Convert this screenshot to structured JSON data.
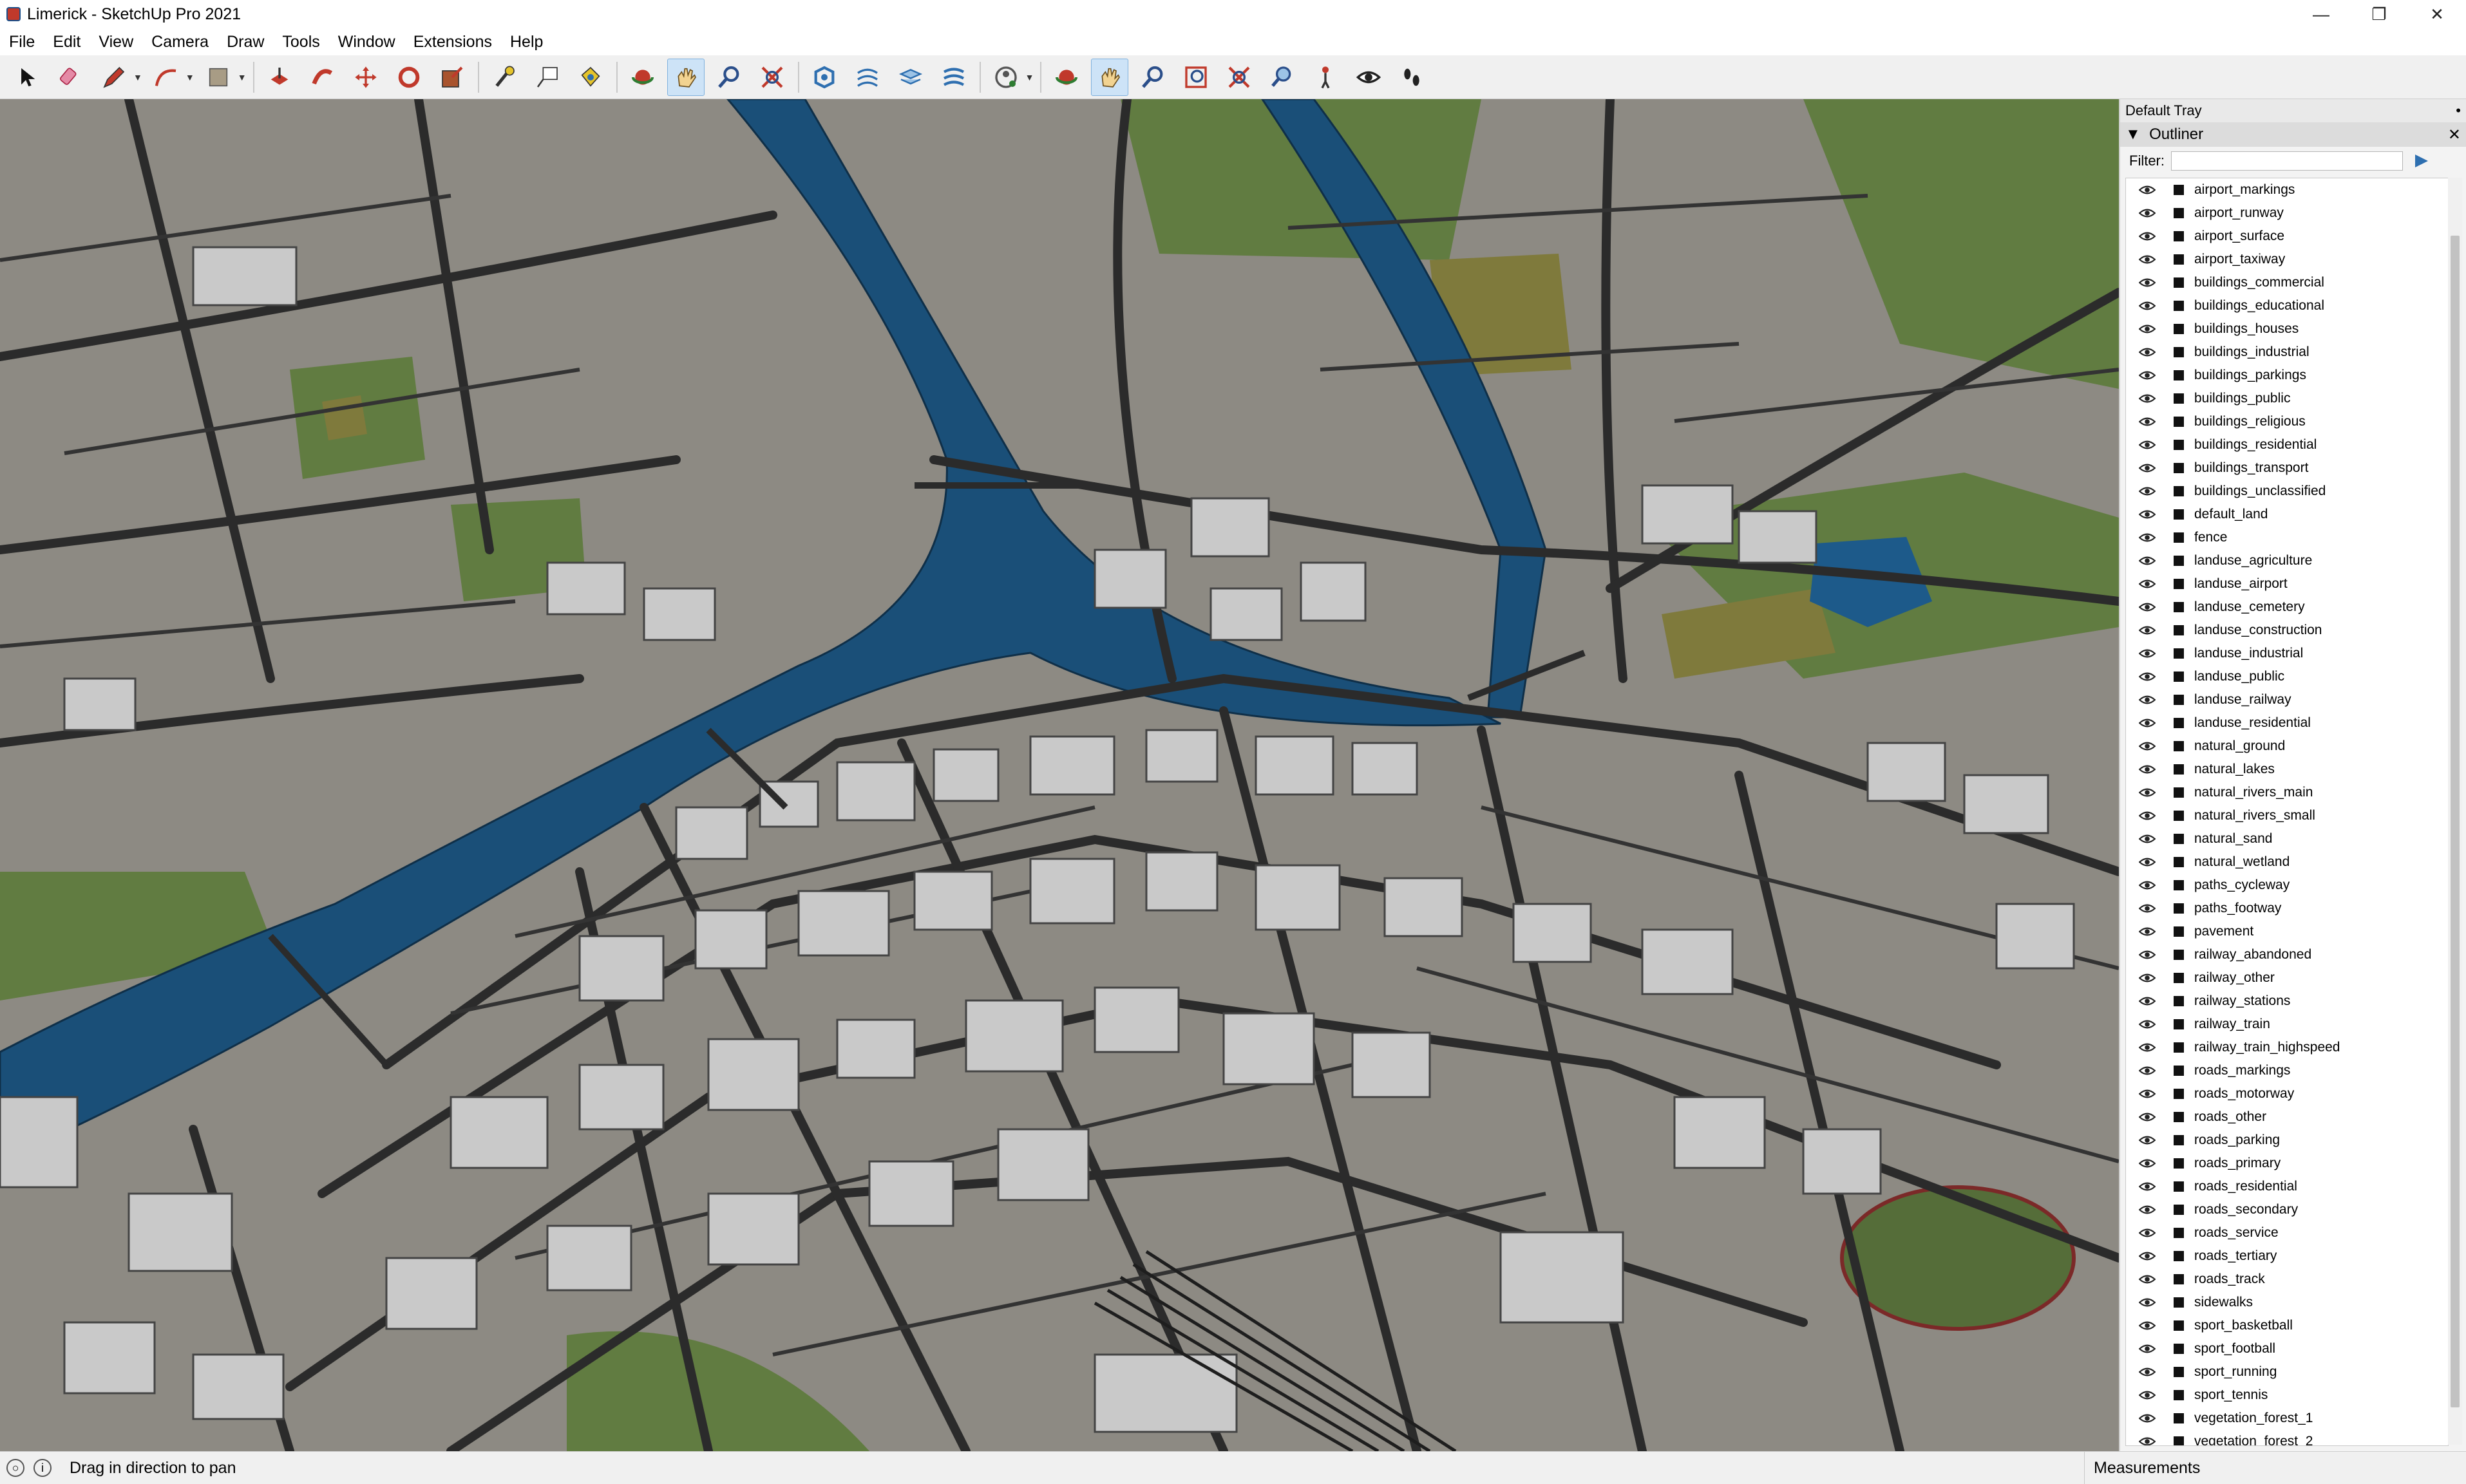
{
  "window": {
    "title": "Limerick - SketchUp Pro 2021",
    "minimize": "—",
    "maximize": "❐",
    "close": "✕"
  },
  "menu": [
    "File",
    "Edit",
    "View",
    "Camera",
    "Draw",
    "Tools",
    "Window",
    "Extensions",
    "Help"
  ],
  "toolbar": {
    "tools": [
      "select-icon",
      "eraser-icon",
      "pencil-icon",
      "arc-icon",
      "rectangle-icon",
      "push-pull-icon",
      "follow-me-icon",
      "move-icon",
      "rotate-icon",
      "scale-icon",
      "tape-measure-icon",
      "text-icon",
      "paint-bucket-icon",
      "orbit-icon",
      "pan-icon",
      "zoom-icon",
      "zoom-extents-icon",
      "geo-location-icon",
      "sandbox-icon",
      "layers-icon",
      "add-location-icon",
      "account-icon",
      "orbit-icon-2",
      "pan-icon-2",
      "zoom-icon-2",
      "zoom-window-icon",
      "zoom-extents-icon-2",
      "previous-view-icon",
      "position-camera-icon",
      "look-around-icon",
      "walk-icon"
    ],
    "active_tool": "pan-icon"
  },
  "tray": {
    "title": "Default Tray",
    "outliner_title": "Outliner",
    "filter_label": "Filter:",
    "filter_value": "",
    "layers": [
      "airport_markings",
      "airport_runway",
      "airport_surface",
      "airport_taxiway",
      "buildings_commercial",
      "buildings_educational",
      "buildings_houses",
      "buildings_industrial",
      "buildings_parkings",
      "buildings_public",
      "buildings_religious",
      "buildings_residential",
      "buildings_transport",
      "buildings_unclassified",
      "default_land",
      "fence",
      "landuse_agriculture",
      "landuse_airport",
      "landuse_cemetery",
      "landuse_construction",
      "landuse_industrial",
      "landuse_public",
      "landuse_railway",
      "landuse_residential",
      "natural_ground",
      "natural_lakes",
      "natural_rivers_main",
      "natural_rivers_small",
      "natural_sand",
      "natural_wetland",
      "paths_cycleway",
      "paths_footway",
      "pavement",
      "railway_abandoned",
      "railway_other",
      "railway_stations",
      "railway_train",
      "railway_train_highspeed",
      "roads_markings",
      "roads_motorway",
      "roads_other",
      "roads_parking",
      "roads_primary",
      "roads_residential",
      "roads_secondary",
      "roads_service",
      "roads_tertiary",
      "roads_track",
      "sidewalks",
      "sport_basketball",
      "sport_football",
      "sport_running",
      "sport_tennis",
      "vegetation_forest_1",
      "vegetation_forest_2"
    ]
  },
  "status": {
    "message": "Drag in direction to pan",
    "measurements_label": "Measurements"
  },
  "colors": {
    "water": "#1a4f78",
    "ground": "#8d8a83",
    "grass": "#5c7a3a",
    "roads": "#2b2b2b",
    "buildings": "#c9c9c9"
  }
}
